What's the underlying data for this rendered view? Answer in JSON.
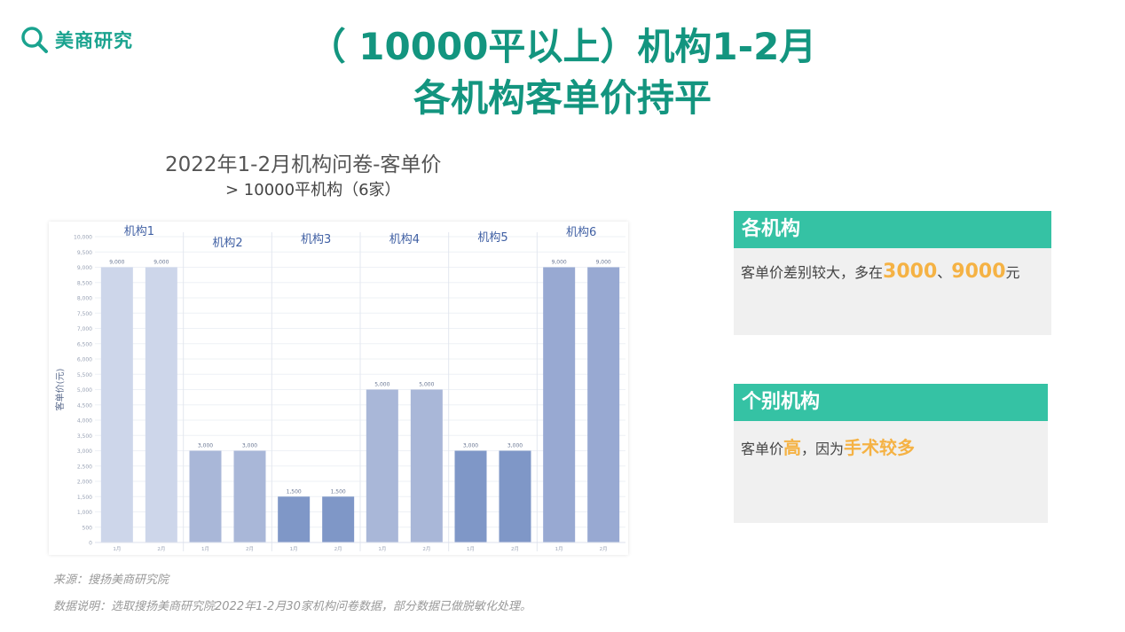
{
  "logo": {
    "text": "美商研究"
  },
  "title": {
    "line1": "（ 10000平以上）机构1-2月",
    "line2": "各机构客单价持平"
  },
  "chart_data": {
    "type": "bar",
    "title": "2022年1-2月机构问卷-客单价",
    "subtitle": "> 10000平机构（6家）",
    "ylabel": "客单价(元)",
    "ylim": [
      0,
      10000
    ],
    "yticks": [
      0,
      500,
      1000,
      1500,
      2000,
      2500,
      3000,
      3500,
      4000,
      4500,
      5000,
      5500,
      6000,
      6500,
      7000,
      7500,
      8000,
      8500,
      9000,
      9500,
      10000
    ],
    "month_labels": [
      "1月",
      "2月"
    ],
    "groups": [
      {
        "name": "机构1",
        "values": [
          9000,
          9000
        ],
        "labels": [
          "9,000",
          "9,000"
        ],
        "color": "#cdd6ea"
      },
      {
        "name": "机构2",
        "values": [
          3000,
          3000
        ],
        "labels": [
          "3,000",
          "3,000"
        ],
        "color": "#a9b7d8"
      },
      {
        "name": "机构3",
        "values": [
          1500,
          1500
        ],
        "labels": [
          "1,500",
          "1,500"
        ],
        "color": "#7f97c7"
      },
      {
        "name": "机构4",
        "values": [
          5000,
          5000
        ],
        "labels": [
          "5,000",
          "5,000"
        ],
        "color": "#a9b7d8"
      },
      {
        "name": "机构5",
        "values": [
          3000,
          3000
        ],
        "labels": [
          "3,000",
          "3,000"
        ],
        "color": "#7f97c7"
      },
      {
        "name": "机构6",
        "values": [
          9000,
          9000
        ],
        "labels": [
          "9,000",
          "9,000"
        ],
        "color": "#98a9d2"
      }
    ]
  },
  "cards": [
    {
      "header": "各机构",
      "text_before": "客单价差别较大，多在",
      "hl1": "3000",
      "sep": "、",
      "hl2": "9000",
      "text_after": "元"
    },
    {
      "header": "个别机构",
      "text_before": "客单价",
      "hl1": "高",
      "text_mid": "，因为",
      "hl2": "手术较多"
    }
  ],
  "footer": {
    "source": "来源：搜扬美商研究院",
    "note": "数据说明：选取搜扬美商研究院2022年1-2月30家机构问卷数据，部分数据已做脱敏化处理。"
  },
  "colors": {
    "accent": "#13957f",
    "card_header": "#35c2a4",
    "highlight": "#f5b244"
  }
}
